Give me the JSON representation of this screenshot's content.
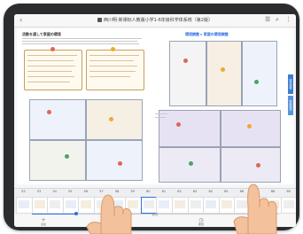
{
  "topbar": {
    "title": "西川明·新课标人教版小学1-6年级科学体系统（第2版）",
    "back_icon": "chevron-left-icon",
    "right_icons": [
      "list-icon",
      "search-icon",
      "more-icon"
    ]
  },
  "page": {
    "left_heading": "活動を通して家庭の環境",
    "right_heading": "環境調整 ▸ 家庭の環境調整",
    "side_tabs": [
      "環境調整",
      "家庭環境"
    ]
  },
  "thumbnails": {
    "pages": [
      "52",
      "53",
      "54",
      "55",
      "56",
      "57",
      "58",
      "59",
      "60",
      "61",
      "62",
      "63",
      "64",
      "65",
      "66",
      "67",
      "68",
      "69"
    ],
    "selected_index": 8
  },
  "slider": {
    "position": 0.18
  },
  "toolbar": {
    "items": [
      {
        "icon": "add-icon",
        "label": "追加"
      },
      {
        "icon": "grid-icon",
        "label": "ページ"
      },
      {
        "icon": "clock-icon",
        "label": "履歴"
      },
      {
        "icon": "pen-icon",
        "label": "ペン"
      }
    ],
    "center_label": "目次"
  },
  "colors": {
    "accent": "#2f6fe0",
    "tablet_frame": "#2b2c30",
    "side_tab": "#3c7fd0"
  }
}
